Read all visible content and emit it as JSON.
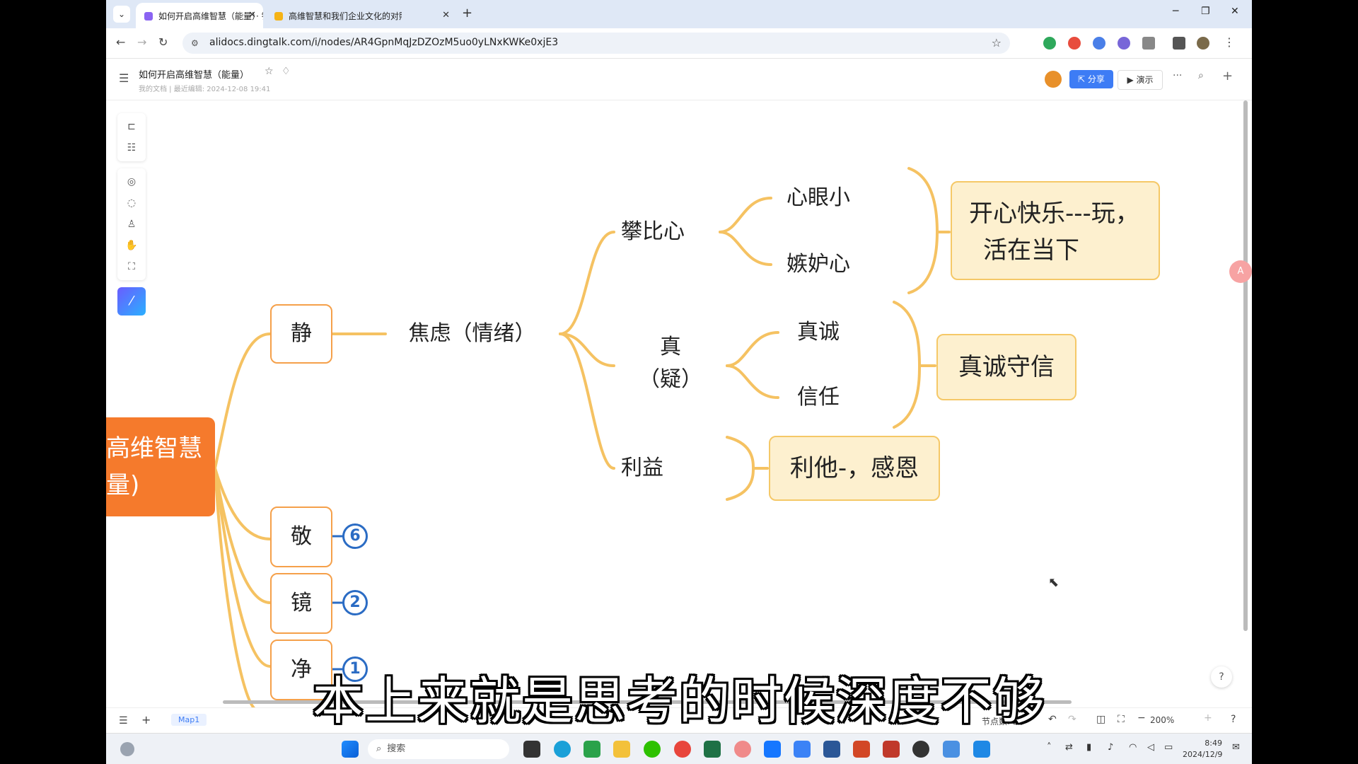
{
  "browser": {
    "tabs": [
      {
        "title": "如何开启高维智慧（能量）· 钉",
        "active": true,
        "favicon_color": "#8a63f2"
      },
      {
        "title": "高维智慧和我们企业文化的对照",
        "active": false,
        "favicon_color": "#f5b316"
      }
    ],
    "url": "alidocs.dingtalk.com/i/nodes/AR4GpnMqJzDZOzM5uo0yLNxKWKe0xjE3"
  },
  "doc": {
    "title": "如何开启高维智慧（能量）",
    "subtitle": "我的文档 | 最近编辑: 2024-12-08 19:41",
    "share_label": "分享",
    "present_label": "演示"
  },
  "mindmap": {
    "root_label_line1": "高维智慧",
    "root_label_line2": "量)",
    "branches": {
      "jing": "静",
      "jing_child": "焦虑（情绪）",
      "panbi": "攀比心",
      "xinyanxiao": "心眼小",
      "jidu": "嫉妒心",
      "note1_line1": "开心快乐---玩，",
      "note1_line2": "活在当下",
      "zhen_line1": "真",
      "zhen_line2": "（疑）",
      "zhencheng": "真诚",
      "xinren": "信任",
      "note2": "真诚守信",
      "liyi": "利益",
      "note3": "利他-，感恩",
      "jing2": "敬",
      "jing2_count": "6",
      "jing3": "镜",
      "jing3_count": "2",
      "jing4": "净",
      "jing4_count": "1"
    }
  },
  "status": {
    "map_tab": "Map1",
    "node_count_label": "节点数: 26",
    "zoom": "200%"
  },
  "taskbar": {
    "search_placeholder": "搜索",
    "time": "8:49",
    "date": "2024/12/9"
  },
  "subtitle": "本上来就是思考的时候深度不够",
  "float_label": "A"
}
